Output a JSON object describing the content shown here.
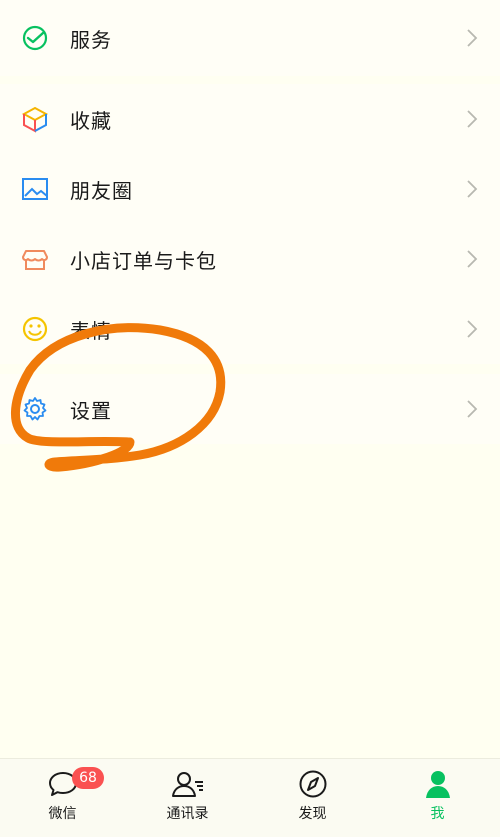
{
  "menu": {
    "services": {
      "label": "服务",
      "icon": "wechat-pay-icon"
    },
    "favorites": {
      "label": "收藏",
      "icon": "cube-icon"
    },
    "moments": {
      "label": "朋友圈",
      "icon": "picture-icon"
    },
    "orders": {
      "label": "小店订单与卡包",
      "icon": "shop-icon"
    },
    "stickers": {
      "label": "表情",
      "icon": "smiley-icon"
    },
    "settings": {
      "label": "设置",
      "icon": "gear-icon"
    }
  },
  "tabbar": {
    "chats": {
      "label": "微信",
      "badge": "68"
    },
    "contacts": {
      "label": "通讯录"
    },
    "discover": {
      "label": "发现"
    },
    "me": {
      "label": "我"
    }
  },
  "colors": {
    "accent": "#07c160",
    "badge": "#fa5151",
    "annotation": "#f07a0a"
  }
}
